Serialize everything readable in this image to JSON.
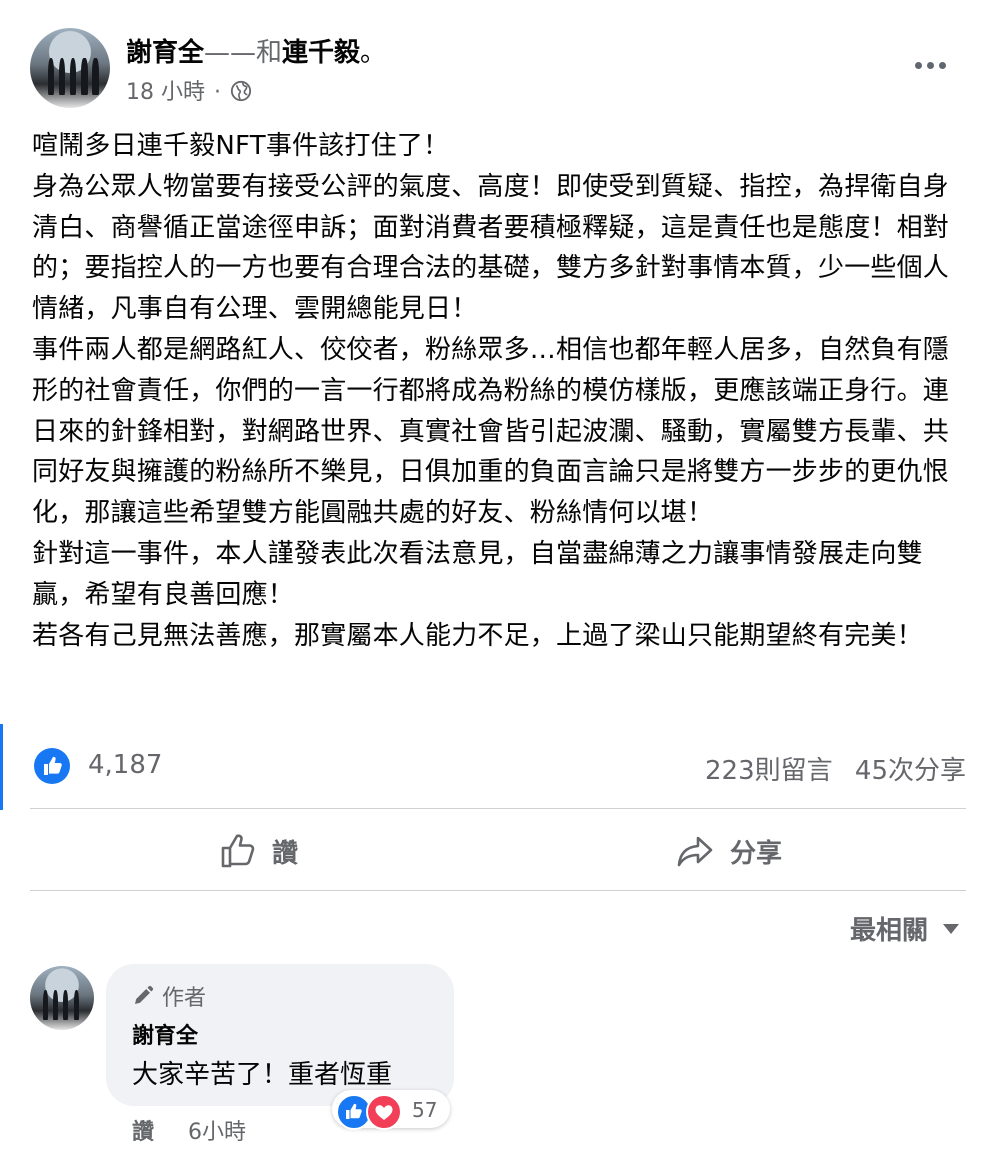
{
  "post": {
    "author": "謝育全",
    "separator": "——和",
    "tagged": "連千毅",
    "tag_suffix": "。",
    "time": "18 小時",
    "time_dot": "·",
    "privacy_icon": "globe-icon",
    "body": "喧鬧多日連千毅NFT事件該打住了！\n身為公眾人物當要有接受公評的氣度、高度！即使受到質疑、指控，為捍衛自身清白、商譽循正當途徑申訴；面對消費者要積極釋疑，這是責任也是態度！相對的；要指控人的一方也要有合理合法的基礎，雙方多針對事情本質，少一些個人情緒，凡事自有公理、雲開總能見日！\n事件兩人都是網路紅人、佼佼者，粉絲眾多…相信也都年輕人居多，自然負有隱形的社會責任，你們的一言一行都將成為粉絲的模仿樣版，更應該端正身行。連日來的針鋒相對，對網路世界、真實社會皆引起波瀾、騷動，實屬雙方長輩、共同好友與擁護的粉絲所不樂見，日俱加重的負面言論只是將雙方一步步的更仇恨化，那讓這些希望雙方能圓融共處的好友、粉絲情何以堪！\n針對這一事件，本人謹發表此次看法意見，自當盡綿薄之力讓事情發展走向雙贏，希望有良善回應！\n若各有己見無法善應，那實屬本人能力不足，上過了梁山只能期望終有完美！"
  },
  "stats": {
    "likes": "4,187",
    "comments": "223則留言",
    "shares": "45次分享"
  },
  "actions": {
    "like_label": "讚",
    "share_label": "分享"
  },
  "comments_section": {
    "sort_label": "最相關"
  },
  "comment": {
    "role_label": "作者",
    "author": "謝育全",
    "text": "大家辛苦了！重者恆重",
    "reaction_count": "57",
    "like_label": "讚",
    "time": "6小時"
  },
  "colors": {
    "accent": "#1877f2",
    "love": "#f33e58",
    "secondary_text": "#65676b"
  }
}
